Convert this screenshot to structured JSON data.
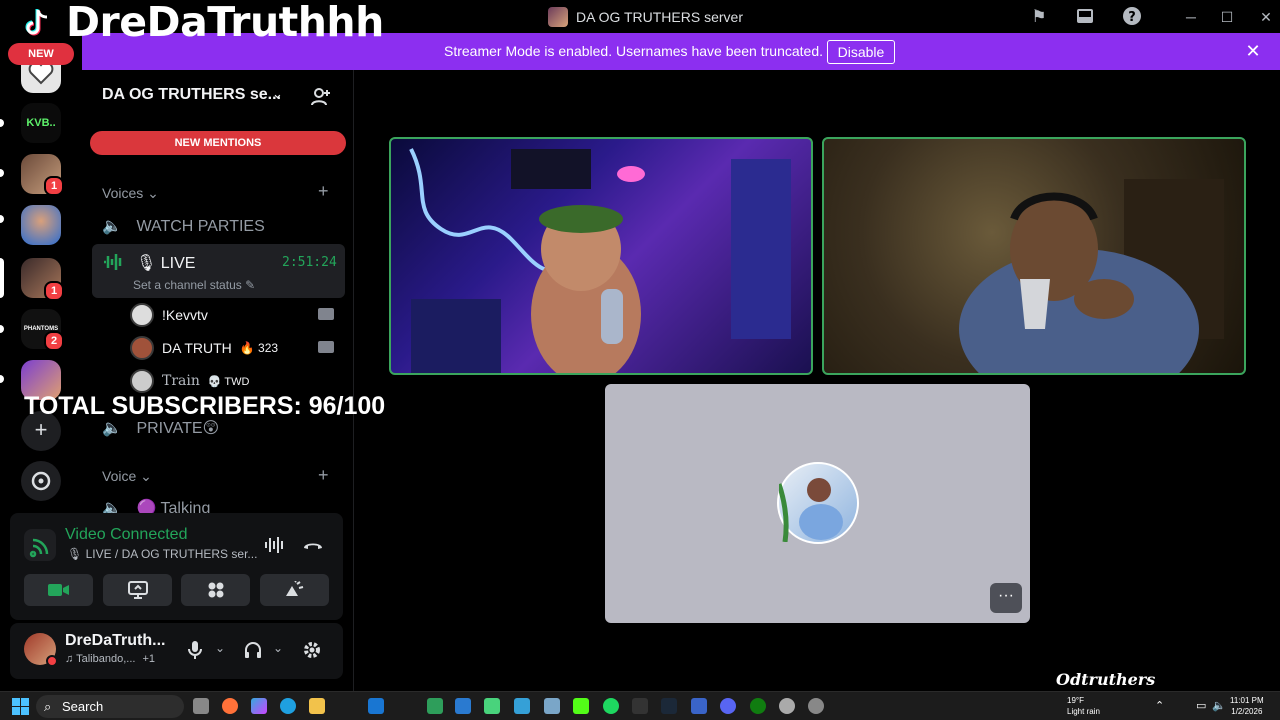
{
  "overlay": {
    "streamer_name": "DreDaTruthhh",
    "subscribers": "TOTAL SUBSCRIBERS: 96/100",
    "watermark": "Odtruthers"
  },
  "titlebar": {
    "title": "DA OG TRUTHERS server",
    "icons": [
      "inbox-flag-icon",
      "inbox-icon",
      "help-icon"
    ],
    "window_controls": [
      "minimize-icon",
      "maximize-icon",
      "close-icon"
    ]
  },
  "banner": {
    "text": "Streamer Mode is enabled. Usernames have been truncated.",
    "button": "Disable",
    "color": "#8c2ff0"
  },
  "rail": {
    "new_label": "NEW",
    "servers": [
      {
        "name": "server-heart",
        "badge": ""
      },
      {
        "name": "server-kvb",
        "label": "KVB..",
        "badge": ""
      },
      {
        "name": "server-1",
        "badge": "1"
      },
      {
        "name": "server-2",
        "badge": ""
      },
      {
        "name": "server-3",
        "badge": "1"
      },
      {
        "name": "server-phantoms",
        "label": "PHANTOMS",
        "badge": "2"
      },
      {
        "name": "server-4",
        "badge": ""
      }
    ],
    "add_server": "plus-icon",
    "discover": "compass-icon"
  },
  "channels": {
    "server_name": "DA OG TRUTHERS se...",
    "new_mentions": "NEW MENTIONS",
    "voices_category": "Voices",
    "voice_category": "Voice",
    "watch_parties": "WATCH PARTIES",
    "live_channel": "LIVE",
    "live_timer": "2:51:24",
    "channel_status": "Set a channel status",
    "private_channel": "PRIVATE😲",
    "talking_channel": "Talking",
    "users": [
      {
        "name": "!Kevvtv",
        "extra": "",
        "video": true
      },
      {
        "name": "DA TRUTH",
        "extra": "🔥 323",
        "video": true
      },
      {
        "name": "Train",
        "extra": "💀 TWD",
        "video": false
      }
    ]
  },
  "voice_panel": {
    "status": "Video Connected",
    "location": "LIVE / DA OG TRUTHERS ser...",
    "accent": "#23a55a"
  },
  "user_panel": {
    "username": "DreDaTruth...",
    "activity": "Talibando,...",
    "activity_extra": "+1"
  },
  "taskbar": {
    "search": "Search",
    "weather_temp": "19°F",
    "weather_desc": "Light rain",
    "time": "11:01 PM",
    "date": "1/2/2026"
  }
}
